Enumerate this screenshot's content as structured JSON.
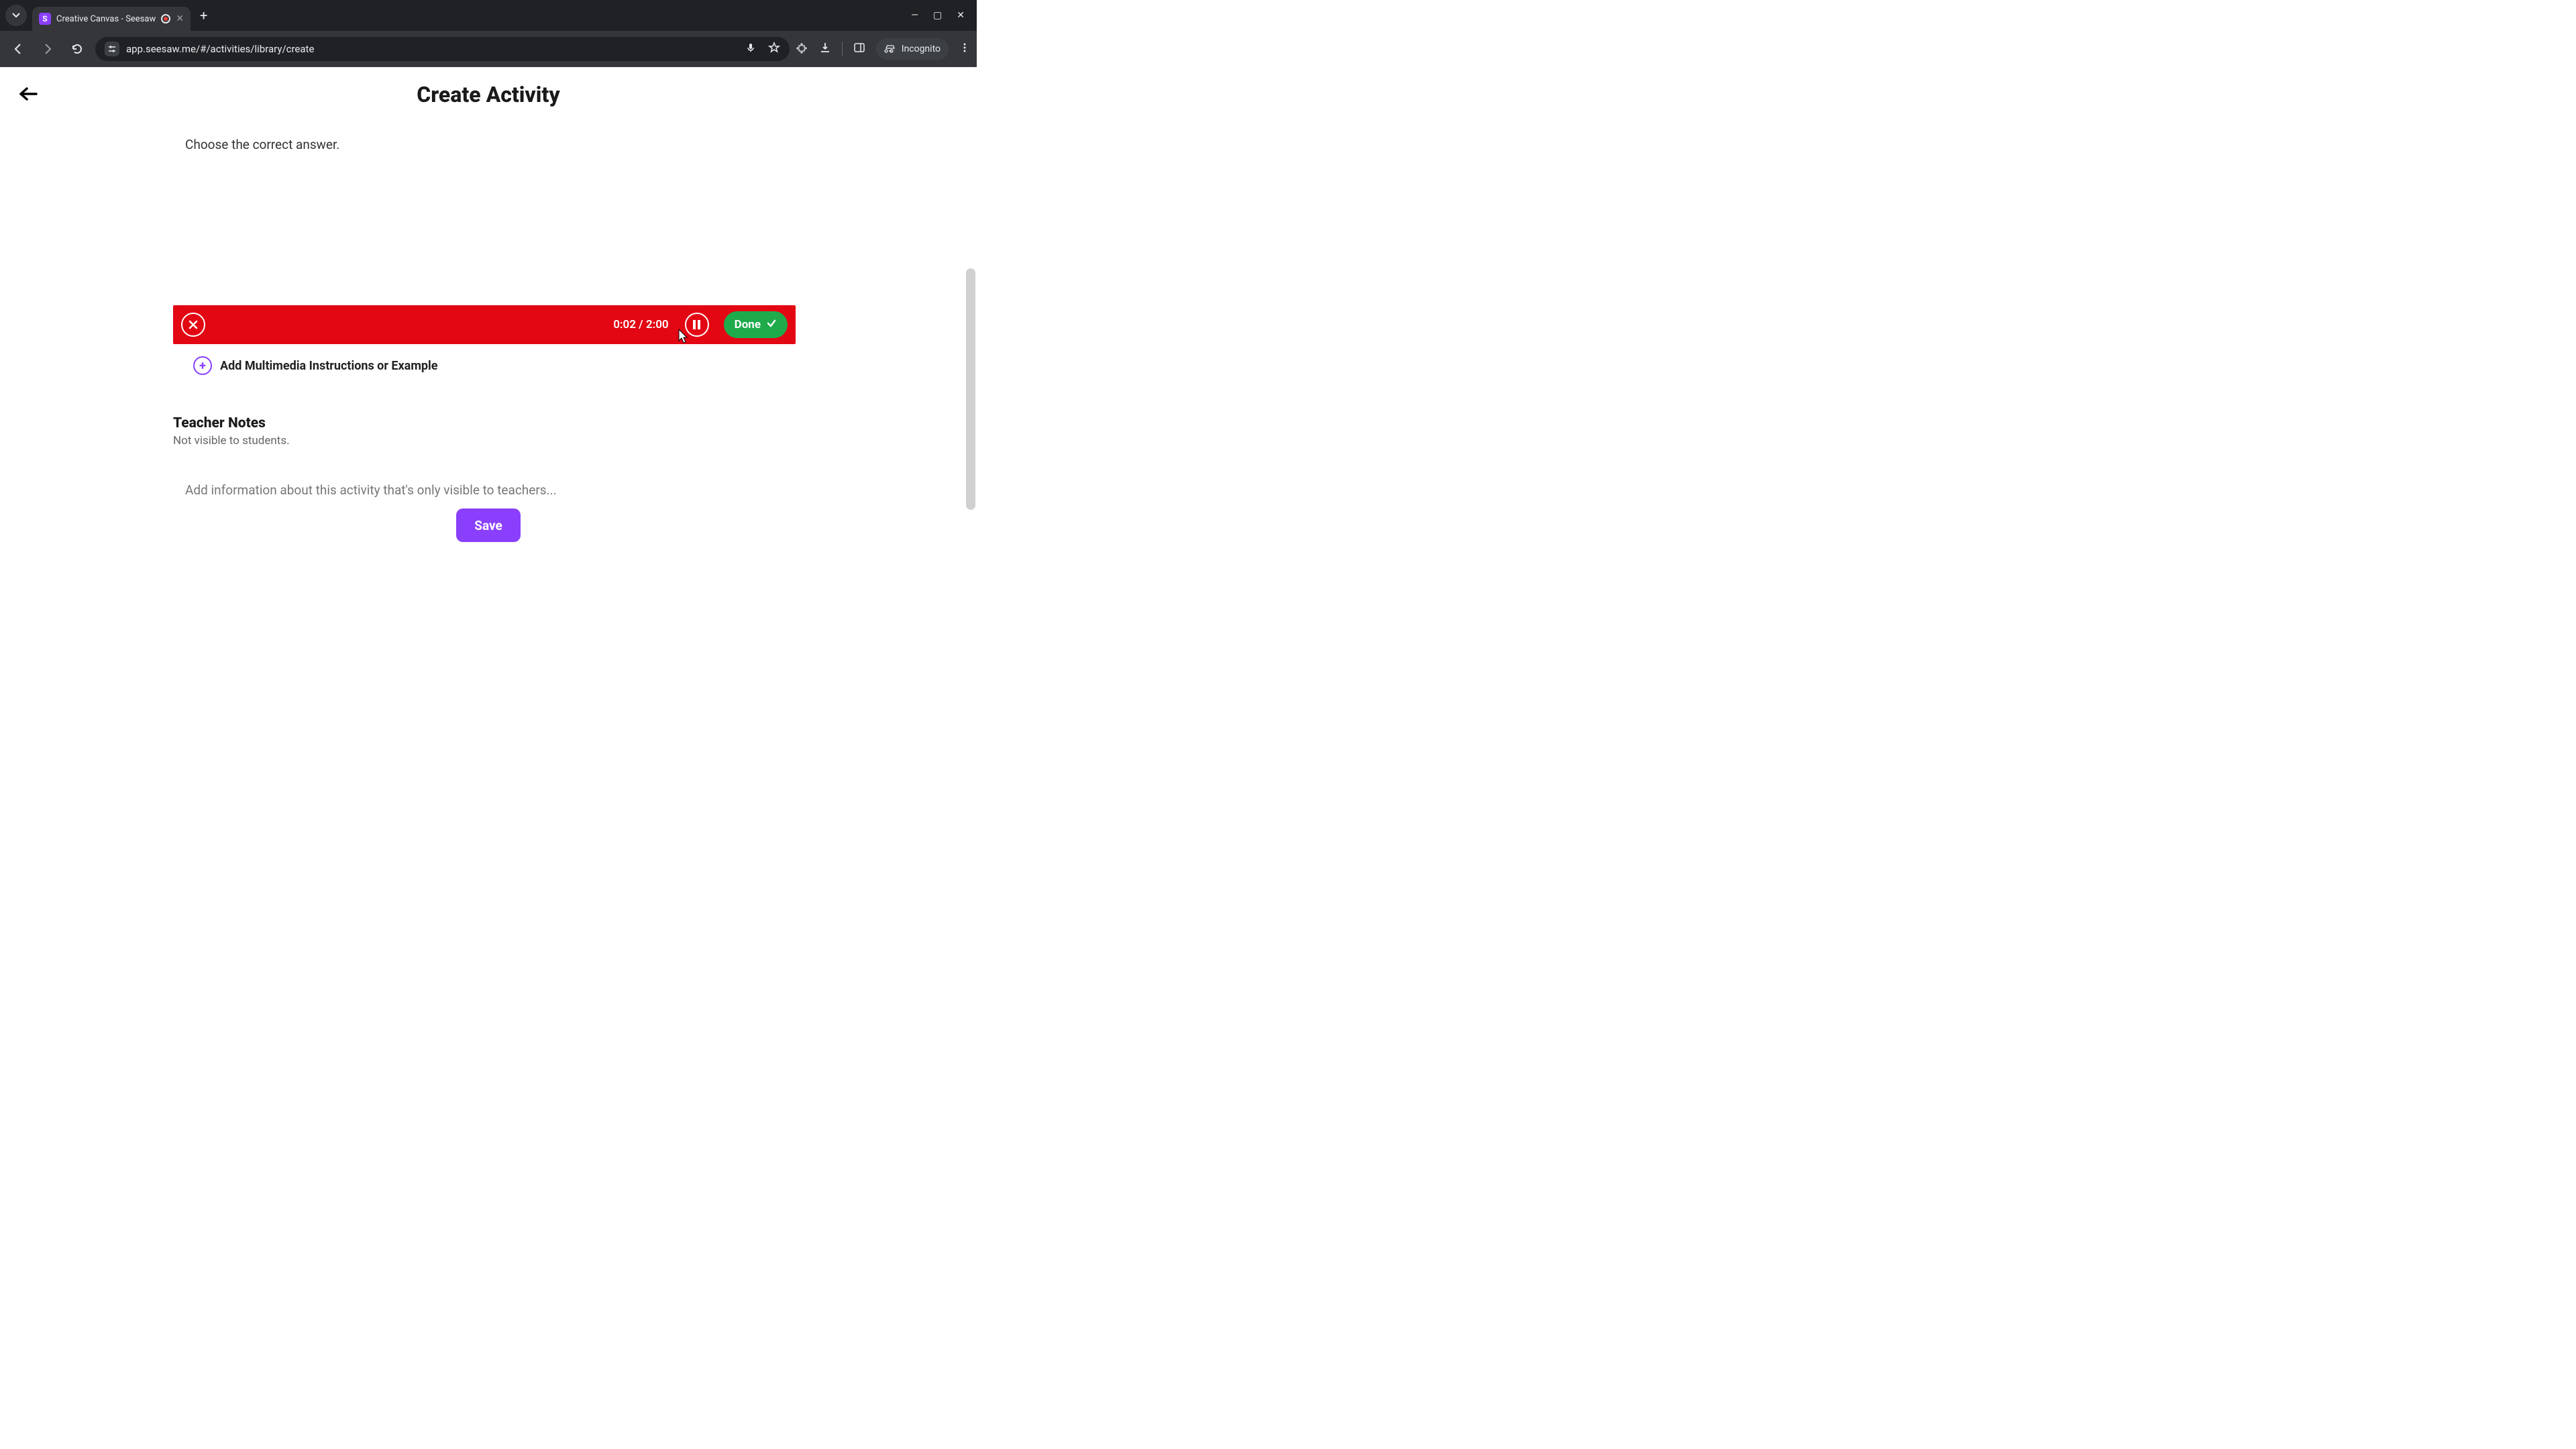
{
  "browser": {
    "tab": {
      "title": "Creative Canvas - Seesaw"
    },
    "url": "app.seesaw.me/#/activities/library/create",
    "incognito_label": "Incognito"
  },
  "header": {
    "title": "Create Activity"
  },
  "editor": {
    "prompt_text": "Choose the correct answer."
  },
  "recorder": {
    "time_display": "0:02 / 2:00",
    "done_label": "Done"
  },
  "multimedia": {
    "add_label": "Add Multimedia Instructions or Example"
  },
  "teacher_notes": {
    "title": "Teacher Notes",
    "subtitle": "Not visible to students.",
    "placeholder": "Add information about this activity that's only visible to teachers..."
  },
  "actions": {
    "save_label": "Save"
  }
}
